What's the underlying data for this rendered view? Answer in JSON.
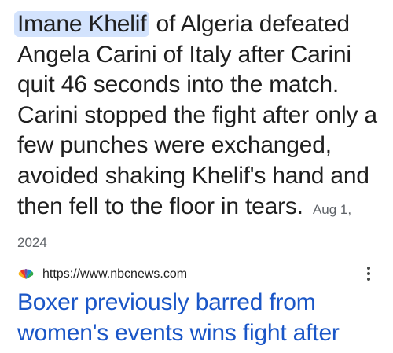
{
  "snippet": {
    "highlighted_name": "Imane Khelif",
    "text": " of Algeria defeated Angela Carini of Italy after Carini quit 46 seconds into the match. Carini stopped the fight after only a few punches were exchanged, avoided shaking Khelif's hand and then fell to the floor in tears.",
    "date": "Aug 1, 2024"
  },
  "result": {
    "url": "https://www.nbcnews.com",
    "favicon": "nbc-peacock-icon",
    "more_icon": "more-vert-icon",
    "title": "Boxer previously barred from women's events wins fight after"
  },
  "colors": {
    "highlight_bg": "#d3e3fd",
    "link": "#1a56c7",
    "date_text": "#5f6368"
  }
}
